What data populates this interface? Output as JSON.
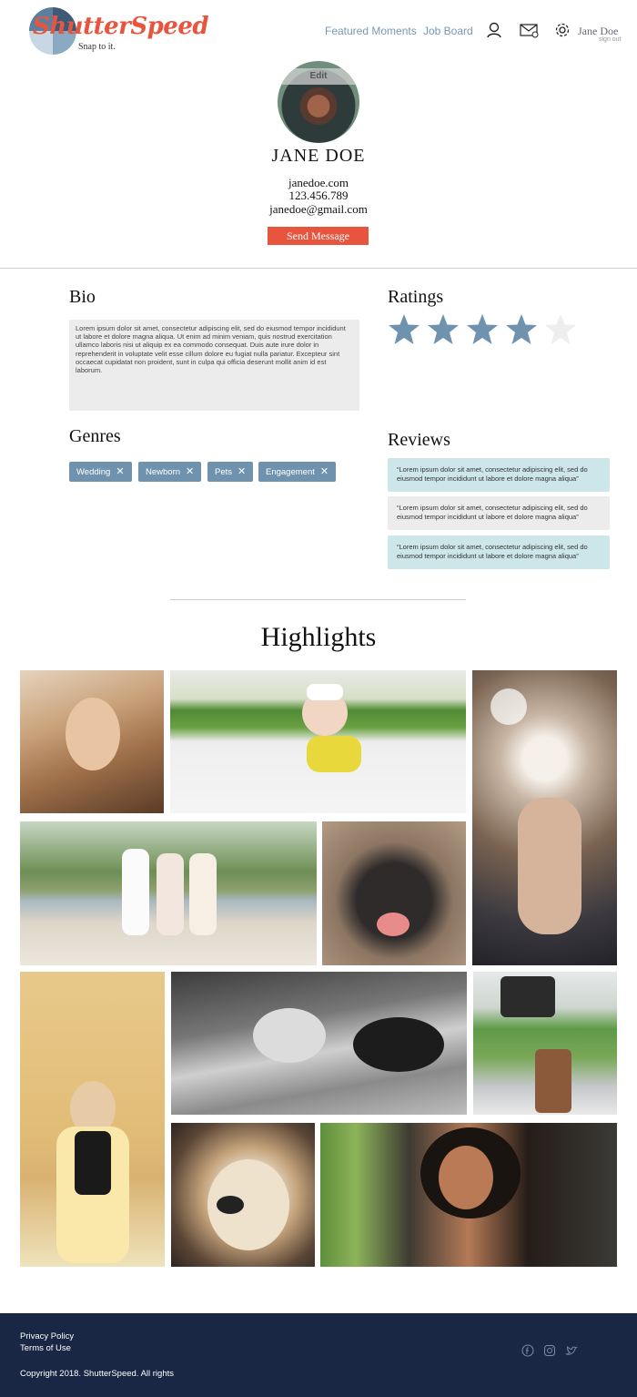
{
  "header": {
    "logo_text": "ShutterSpeed",
    "tagline": "Snap to it.",
    "nav": {
      "featured": "Featured Moments",
      "jobs": "Job Board"
    },
    "icons": [
      "user-icon",
      "mail-icon",
      "gear-icon"
    ],
    "user_name": "Jane Doe",
    "sign_out": "sign out"
  },
  "profile": {
    "edit_label": "Edit",
    "name": "JANE DOE",
    "website": "janedoe.com",
    "phone": "123.456.789",
    "email": "janedoe@gmail.com",
    "send_message": "Send Message"
  },
  "bio": {
    "title": "Bio",
    "text": "Lorem ipsum dolor sit amet, consectetur adipiscing elit, sed do eiusmod tempor incididunt ut labore et dolore magna aliqua. Ut enim ad minim veniam, quis nostrud exercitation ullamco laboris nisi ut aliquip ex ea commodo consequat. Duis aute irure dolor in reprehenderit in voluptate velit esse cillum dolore eu fugiat nulla pariatur. Excepteur sint occaecat cupidatat non proident, sunt in culpa qui officia deserunt mollit anim id est laborum."
  },
  "ratings": {
    "title": "Ratings",
    "value": 4,
    "max": 5,
    "colors": {
      "filled": "#6f93af",
      "empty": "#eeeeee"
    }
  },
  "genres": {
    "title": "Genres",
    "items": [
      "Wedding",
      "Newborn",
      "Pets",
      "Engagement"
    ],
    "remove_glyph": "✕"
  },
  "reviews": {
    "title": "Reviews",
    "items": [
      "“Lorem ipsum dolor sit amet, consectetur adipiscing elit, sed do eiusmod tempor incididunt ut labore et dolore magna aliqua”",
      "“Lorem ipsum dolor sit amet, consectetur adipiscing elit, sed do eiusmod tempor incididunt ut labore et dolore magna aliqua”",
      "“Lorem ipsum dolor sit amet, consectetur adipiscing elit, sed do eiusmod tempor incididunt ut labore et dolore magna aliqua”"
    ]
  },
  "highlights": {
    "title": "Highlights",
    "photos": [
      "portrait-woman-blonde",
      "baby-on-blanket",
      "couple-sparklers",
      "three-women-beach",
      "husky-puppy",
      "woman-yellow-cardigan",
      "woman-lying-black-white",
      "graduation-cap-boots",
      "labrador-dog",
      "woman-curly-hair-smiling"
    ]
  },
  "footer": {
    "privacy": "Privacy Policy",
    "terms": "Terms of Use",
    "copyright": "Copyright 2018. ShutterSpeed. All rights",
    "social_icons": [
      "facebook-icon",
      "instagram-icon",
      "twitter-icon"
    ]
  },
  "colors": {
    "accent": "#e8553e",
    "link": "#7797b6",
    "chip": "#6f93af",
    "review_blue": "#cde6ea",
    "footer": "#1a2744"
  }
}
